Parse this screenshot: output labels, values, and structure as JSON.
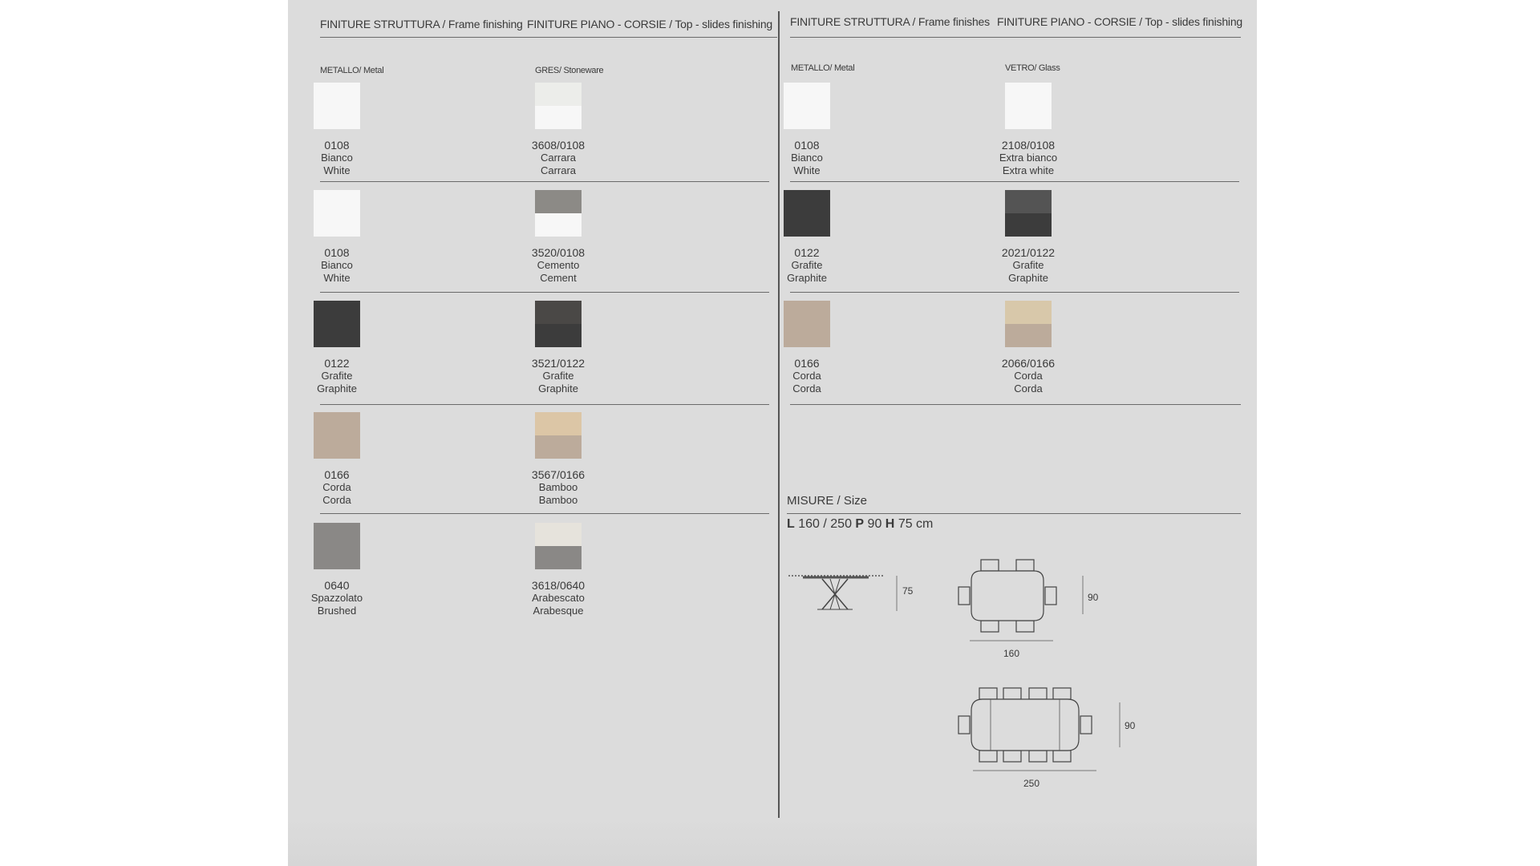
{
  "left": {
    "header_frame": "FINITURE STRUTTURA / Frame finishing",
    "header_top": "FINITURE PIANO - CORSIE / Top - slides finishing",
    "cat_frame": "METALLO/ Metal",
    "cat_top": "GRES/ Stoneware",
    "rows": [
      {
        "frame": {
          "code": "0108",
          "name1": "Bianco",
          "name2": "White",
          "color": "#f7f7f7"
        },
        "top": {
          "code": "3608/0108",
          "name1": "Carrara",
          "name2": "Carrara",
          "color_top": "#ecedea",
          "color_bottom": "#f7f7f7"
        }
      },
      {
        "frame": {
          "code": "0108",
          "name1": "Bianco",
          "name2": "White",
          "color": "#f7f7f7"
        },
        "top": {
          "code": "3520/0108",
          "name1": "Cemento",
          "name2": "Cement",
          "color_top": "#8c8a86",
          "color_bottom": "#f7f7f7"
        }
      },
      {
        "frame": {
          "code": "0122",
          "name1": "Grafite",
          "name2": "Graphite",
          "color": "#3c3c3c"
        },
        "top": {
          "code": "3521/0122",
          "name1": "Grafite",
          "name2": "Graphite",
          "color_top": "#4a4846",
          "color_bottom": "#3c3c3c"
        }
      },
      {
        "frame": {
          "code": "0166",
          "name1": "Corda",
          "name2": "Corda",
          "color": "#bcab9b"
        },
        "top": {
          "code": "3567/0166",
          "name1": "Bamboo",
          "name2": "Bamboo",
          "color_top": "#dcc6a6",
          "color_bottom": "#bcab9b"
        }
      },
      {
        "frame": {
          "code": "0640",
          "name1": "Spazzolato",
          "name2": "Brushed",
          "color": "#8a8886"
        },
        "top": {
          "code": "3618/0640",
          "name1": "Arabescato",
          "name2": "Arabesque",
          "color_top": "#e6e3dc",
          "color_bottom": "#8a8886"
        }
      }
    ]
  },
  "right": {
    "header_frame": "FINITURE STRUTTURA / Frame finishes",
    "header_top": "FINITURE PIANO - CORSIE / Top - slides finishing",
    "cat_frame": "METALLO/ Metal",
    "cat_top": "VETRO/ Glass",
    "rows": [
      {
        "frame": {
          "code": "0108",
          "name1": "Bianco",
          "name2": "White",
          "color": "#f7f7f7"
        },
        "top": {
          "code": "2108/0108",
          "name1": "Extra bianco",
          "name2": "Extra white",
          "color_top": "#f7f7f7",
          "color_bottom": "#f7f7f7"
        }
      },
      {
        "frame": {
          "code": "0122",
          "name1": "Grafite",
          "name2": "Graphite",
          "color": "#3c3c3c"
        },
        "top": {
          "code": "2021/0122",
          "name1": "Grafite",
          "name2": "Graphite",
          "color_top": "#545454",
          "color_bottom": "#3c3c3c"
        }
      },
      {
        "frame": {
          "code": "0166",
          "name1": "Corda",
          "name2": "Corda",
          "color": "#bcab9b"
        },
        "top": {
          "code": "2066/0166",
          "name1": "Corda",
          "name2": "Corda",
          "color_top": "#d8c8aa",
          "color_bottom": "#bcab9b"
        }
      }
    ]
  },
  "size": {
    "title": "MISURE / Size",
    "l_label": "L",
    "l_value": "160 / 250",
    "p_label": "P",
    "p_value": "90",
    "h_label": "H",
    "h_value": "75 cm",
    "dim_height": "75",
    "dim_depth_small": "90",
    "dim_len_small": "160",
    "dim_depth_large": "90",
    "dim_len_large": "250"
  }
}
